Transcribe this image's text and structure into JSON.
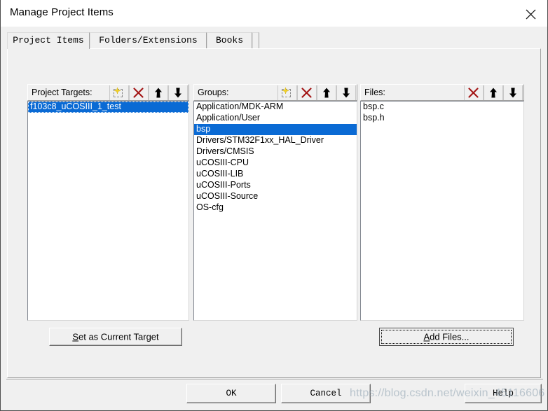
{
  "window": {
    "title": "Manage Project Items",
    "close_icon": "close-icon"
  },
  "tabs": [
    {
      "label": "Project Items",
      "selected": true
    },
    {
      "label": "Folders/Extensions",
      "selected": false
    },
    {
      "label": "Books",
      "selected": false
    }
  ],
  "columns": {
    "targets": {
      "header": "Project Targets:",
      "buttons": [
        "new-item-icon",
        "delete-icon",
        "move-up-icon",
        "move-down-icon"
      ],
      "items": [
        {
          "label": "f103c8_uCOSIII_1_test",
          "selected": true,
          "focused": true
        }
      ]
    },
    "groups": {
      "header": "Groups:",
      "buttons": [
        "new-item-icon",
        "delete-icon",
        "move-up-icon",
        "move-down-icon"
      ],
      "items": [
        {
          "label": "Application/MDK-ARM",
          "selected": false
        },
        {
          "label": "Application/User",
          "selected": false
        },
        {
          "label": "bsp",
          "selected": true
        },
        {
          "label": "Drivers/STM32F1xx_HAL_Driver",
          "selected": false
        },
        {
          "label": "Drivers/CMSIS",
          "selected": false
        },
        {
          "label": "uCOSIII-CPU",
          "selected": false
        },
        {
          "label": "uCOSIII-LIB",
          "selected": false
        },
        {
          "label": "uCOSIII-Ports",
          "selected": false
        },
        {
          "label": "uCOSIII-Source",
          "selected": false
        },
        {
          "label": "OS-cfg",
          "selected": false
        }
      ]
    },
    "files": {
      "header": "Files:",
      "buttons": [
        "delete-icon",
        "move-up-icon",
        "move-down-icon"
      ],
      "items": [
        {
          "label": "bsp.c",
          "selected": false
        },
        {
          "label": "bsp.h",
          "selected": false
        }
      ]
    }
  },
  "buttons": {
    "set_as_current_target": {
      "accel": "S",
      "rest": "et as Current Target"
    },
    "add_files": {
      "accel": "A",
      "rest": "dd Files..."
    },
    "ok": "OK",
    "cancel": "Cancel",
    "help": "Help"
  },
  "watermark": "https://blog.csdn.net/weixin_45116606",
  "colors": {
    "selection": "#0a6ad4",
    "dialog_face": "#f0f0f0",
    "listbox_bg": "#ffffff",
    "delete_icon": "#a31515",
    "sparkle": "#f2d024"
  }
}
